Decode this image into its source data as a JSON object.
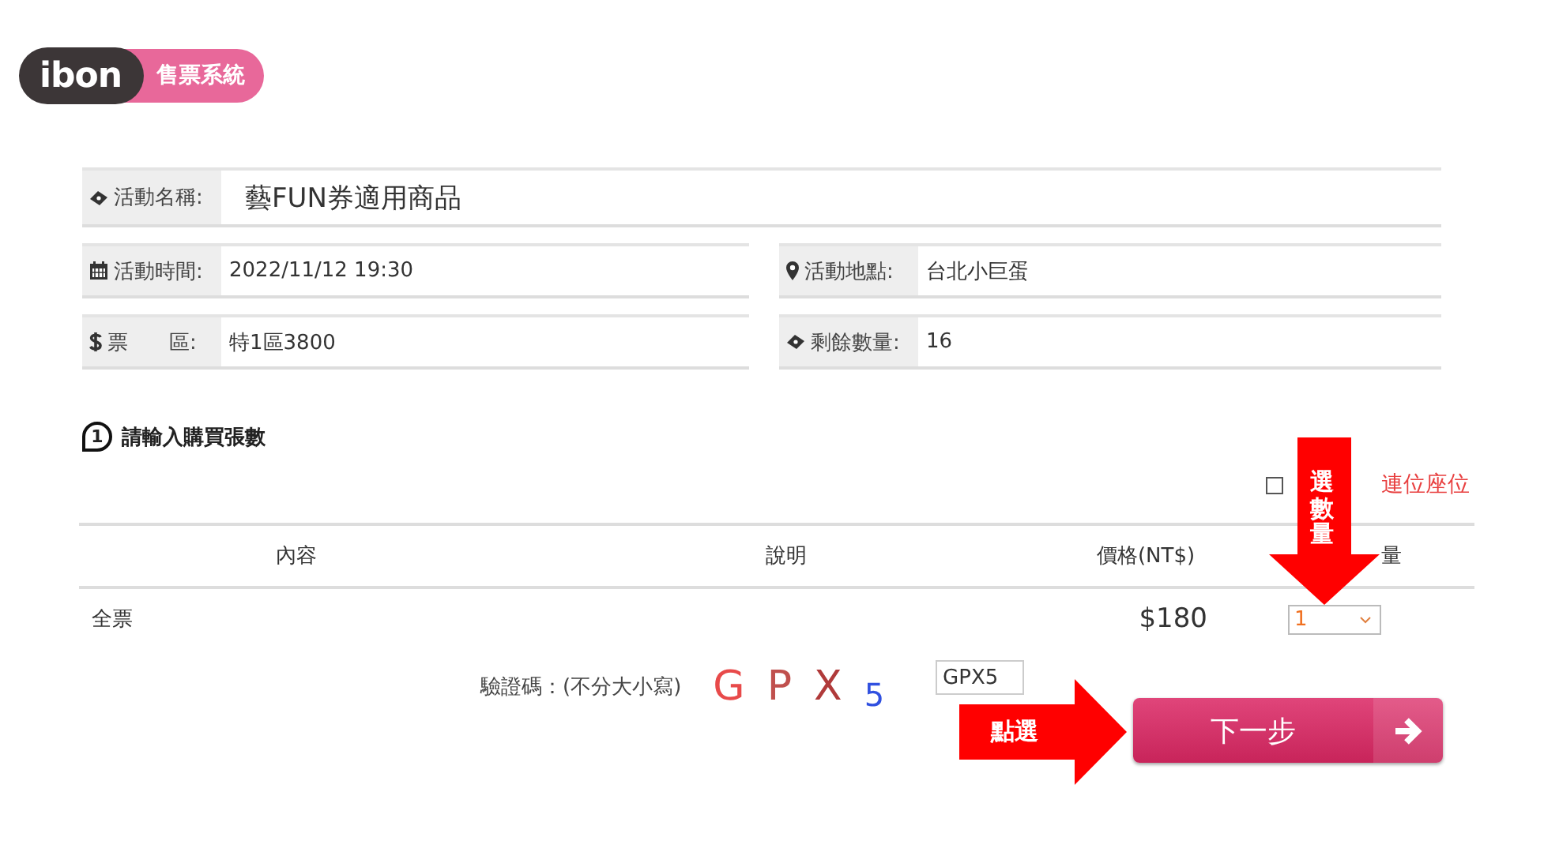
{
  "logo": {
    "brand": "ibon",
    "system": "售票系統"
  },
  "event_info": [
    {
      "kind": "name",
      "label": "活動名稱:",
      "value": "藝FUN券適用商品"
    },
    {
      "kind": "time",
      "label": "活動時間:",
      "value": "2022/11/12 19:30"
    },
    {
      "kind": "place",
      "label": "活動地點:",
      "value": "台北小巨蛋"
    },
    {
      "kind": "area",
      "label": "票　　區:",
      "value": "特1區3800"
    },
    {
      "kind": "remaining",
      "label": "剩餘數量:",
      "value": "16"
    }
  ],
  "step": {
    "number": "1",
    "title": "請輸入購買張數"
  },
  "non_adjacent_option": {
    "label": "連位座位",
    "checked": false
  },
  "table": {
    "columns": [
      "內容",
      "說明",
      "價格(NT$)",
      "量"
    ],
    "rows": [
      {
        "content": "全票",
        "price": "$180",
        "quantity": "1"
      }
    ]
  },
  "captcha": {
    "label": "驗證碼：(不分大小寫)",
    "chars": [
      {
        "char": "G",
        "color": "#e84a4a"
      },
      {
        "char": "P",
        "color": "#c0504d"
      },
      {
        "char": "X",
        "color": "#b03a3a"
      },
      {
        "char": "5",
        "color": "#3050e0"
      }
    ],
    "value": "GPX5"
  },
  "next_button": {
    "label": "下一步"
  },
  "annotations": [
    {
      "kind": "down",
      "text": "選數量"
    },
    {
      "kind": "right",
      "text": "點選"
    }
  ]
}
